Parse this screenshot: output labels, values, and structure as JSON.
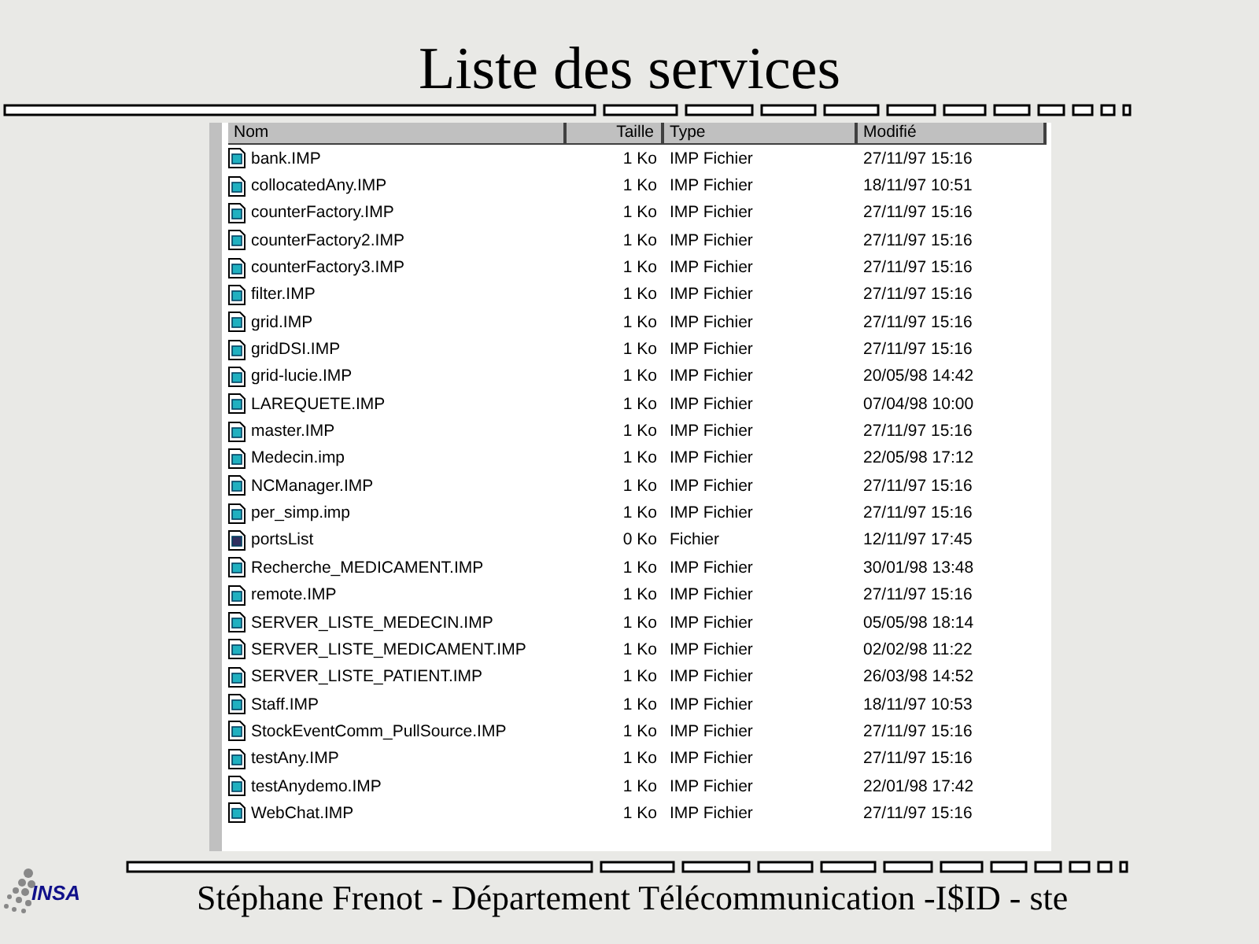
{
  "slide": {
    "title": "Liste des services"
  },
  "explorer": {
    "columns": [
      {
        "label": "Nom"
      },
      {
        "label": "Taille"
      },
      {
        "label": "Type"
      },
      {
        "label": "Modifié"
      }
    ],
    "rows": [
      {
        "kind": "imp",
        "name": "bank.IMP",
        "size": "1 Ko",
        "type": "IMP Fichier",
        "modified": "27/11/97 15:16"
      },
      {
        "kind": "imp",
        "name": "collocatedAny.IMP",
        "size": "1 Ko",
        "type": "IMP Fichier",
        "modified": "18/11/97 10:51"
      },
      {
        "kind": "imp",
        "name": "counterFactory.IMP",
        "size": "1 Ko",
        "type": "IMP Fichier",
        "modified": "27/11/97 15:16"
      },
      {
        "kind": "imp",
        "name": "counterFactory2.IMP",
        "size": "1 Ko",
        "type": "IMP Fichier",
        "modified": "27/11/97 15:16"
      },
      {
        "kind": "imp",
        "name": "counterFactory3.IMP",
        "size": "1 Ko",
        "type": "IMP Fichier",
        "modified": "27/11/97 15:16"
      },
      {
        "kind": "imp",
        "name": "filter.IMP",
        "size": "1 Ko",
        "type": "IMP Fichier",
        "modified": "27/11/97 15:16"
      },
      {
        "kind": "imp",
        "name": "grid.IMP",
        "size": "1 Ko",
        "type": "IMP Fichier",
        "modified": "27/11/97 15:16"
      },
      {
        "kind": "imp",
        "name": "gridDSI.IMP",
        "size": "1 Ko",
        "type": "IMP Fichier",
        "modified": "27/11/97 15:16"
      },
      {
        "kind": "imp",
        "name": "grid-lucie.IMP",
        "size": "1 Ko",
        "type": "IMP Fichier",
        "modified": "20/05/98 14:42"
      },
      {
        "kind": "imp",
        "name": "LAREQUETE.IMP",
        "size": "1 Ko",
        "type": "IMP Fichier",
        "modified": "07/04/98 10:00"
      },
      {
        "kind": "imp",
        "name": "master.IMP",
        "size": "1 Ko",
        "type": "IMP Fichier",
        "modified": "27/11/97 15:16"
      },
      {
        "kind": "imp",
        "name": "Medecin.imp",
        "size": "1 Ko",
        "type": "IMP Fichier",
        "modified": "22/05/98 17:12"
      },
      {
        "kind": "imp",
        "name": "NCManager.IMP",
        "size": "1 Ko",
        "type": "IMP Fichier",
        "modified": "27/11/97 15:16"
      },
      {
        "kind": "imp",
        "name": "per_simp.imp",
        "size": "1 Ko",
        "type": "IMP Fichier",
        "modified": "27/11/97 15:16"
      },
      {
        "kind": "generic",
        "name": "portsList",
        "size": "0 Ko",
        "type": "Fichier",
        "modified": "12/11/97 17:45"
      },
      {
        "kind": "imp",
        "name": "Recherche_MEDICAMENT.IMP",
        "size": "1 Ko",
        "type": "IMP Fichier",
        "modified": "30/01/98 13:48"
      },
      {
        "kind": "imp",
        "name": "remote.IMP",
        "size": "1 Ko",
        "type": "IMP Fichier",
        "modified": "27/11/97 15:16"
      },
      {
        "kind": "imp",
        "name": "SERVER_LISTE_MEDECIN.IMP",
        "size": "1 Ko",
        "type": "IMP Fichier",
        "modified": "05/05/98 18:14"
      },
      {
        "kind": "imp",
        "name": "SERVER_LISTE_MEDICAMENT.IMP",
        "size": "1 Ko",
        "type": "IMP Fichier",
        "modified": "02/02/98 11:22"
      },
      {
        "kind": "imp",
        "name": "SERVER_LISTE_PATIENT.IMP",
        "size": "1 Ko",
        "type": "IMP Fichier",
        "modified": "26/03/98 14:52"
      },
      {
        "kind": "imp",
        "name": "Staff.IMP",
        "size": "1 Ko",
        "type": "IMP Fichier",
        "modified": "18/11/97 10:53"
      },
      {
        "kind": "imp",
        "name": "StockEventComm_PullSource.IMP",
        "size": "1 Ko",
        "type": "IMP Fichier",
        "modified": "27/11/97 15:16"
      },
      {
        "kind": "imp",
        "name": "testAny.IMP",
        "size": "1 Ko",
        "type": "IMP Fichier",
        "modified": "27/11/97 15:16"
      },
      {
        "kind": "imp",
        "name": "testAnydemo.IMP",
        "size": "1 Ko",
        "type": "IMP Fichier",
        "modified": "22/01/98 17:42"
      },
      {
        "kind": "imp",
        "name": "WebChat.IMP",
        "size": "1 Ko",
        "type": "IMP Fichier",
        "modified": "27/11/97 15:16"
      }
    ]
  },
  "footer": {
    "logo": "INSA",
    "text": "Stéphane Frenot - Département Télécommunication -I$ID - ste"
  }
}
